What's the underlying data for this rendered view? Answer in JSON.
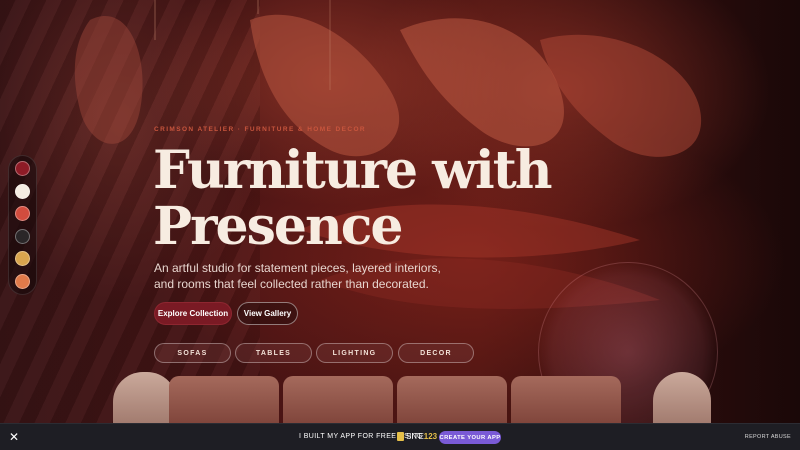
{
  "hero": {
    "eyebrow": "CRIMSON ATELIER · FURNITURE & HOME DECOR",
    "title_line1": "Furniture with",
    "title_line2": "Presence",
    "subtitle": "An artful studio for statement pieces, layered interiors, and rooms that feel collected rather than decorated.",
    "primary_button": "Explore Collection",
    "secondary_button": "View Gallery"
  },
  "categories": [
    "SOFAS",
    "TABLES",
    "LIGHTING",
    "DECOR"
  ],
  "theme_swatches": [
    {
      "name": "crimson",
      "color": "#8e1b26"
    },
    {
      "name": "cream",
      "color": "#f4ece2"
    },
    {
      "name": "coral",
      "color": "#d24c3e"
    },
    {
      "name": "charcoal",
      "color": "#2a2628"
    },
    {
      "name": "mustard",
      "color": "#d9a54e"
    },
    {
      "name": "terracotta",
      "color": "#e07a4a"
    }
  ],
  "bottom_bar": {
    "built_text": "I BUILT MY APP FOR FREE USING",
    "logo_text": "SITE",
    "logo_num": "123",
    "create_button": "CREATE YOUR APP",
    "report": "REPORT ABUSE",
    "close_icon": "close-icon"
  },
  "colors": {
    "accent": "#7a1a24",
    "eyebrow": "#c8553d",
    "title": "#f7ece1",
    "create_button": "#7a5ad6"
  }
}
